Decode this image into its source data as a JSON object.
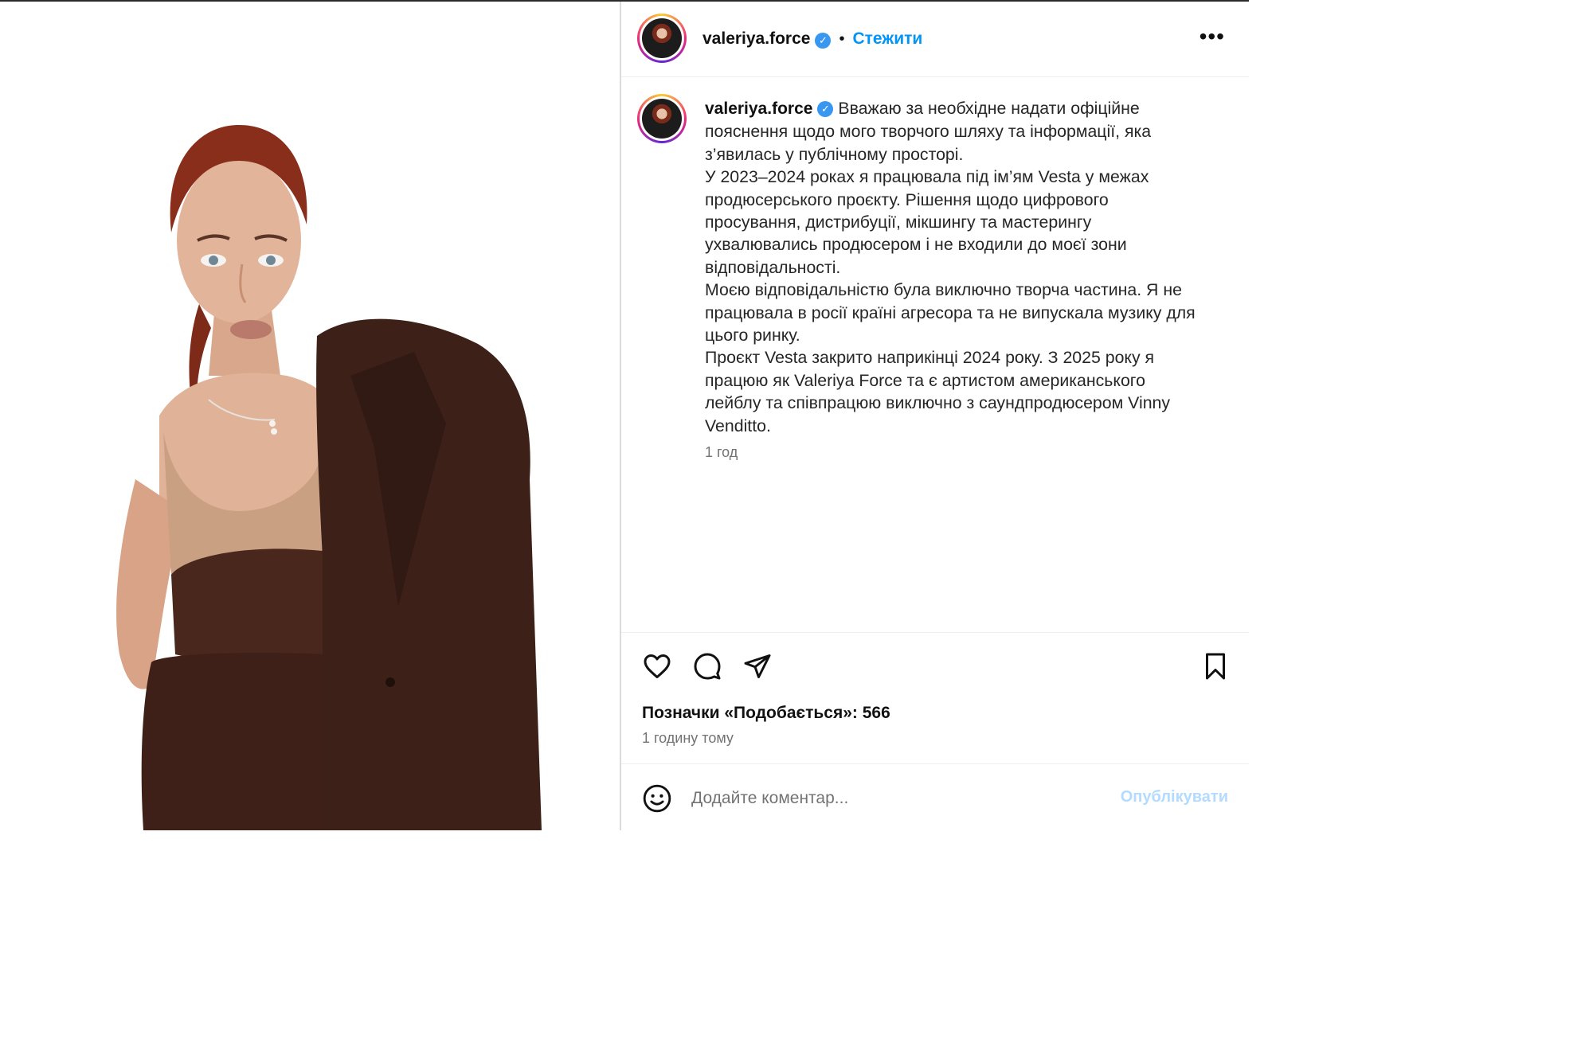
{
  "header": {
    "username": "valeriya.force",
    "separator": "•",
    "follow_label": "Стежити",
    "more_label": "•••"
  },
  "caption": {
    "username": "valeriya.force",
    "paragraphs": [
      "Вважаю за необхідне надати офіційне пояснення щодо мого творчого шляху та інформації, яка з’явилась у публічному просторі.",
      "У 2023–2024 роках я працювала під ім’ям Vesta у межах продюсерського проєкту. Рішення щодо цифрового просування, дистрибуції, мікшингу та мастерингу ухвалювались продюсером і не входили до моєї зони відповідальності.",
      "Моєю відповідальністю була виключно творча частина. Я не працювала в росії країні агресора та не випускала музику для цього ринку.",
      "Проєкт Vesta закрито наприкінці 2024 року. З 2025 року я працюю як Valeriya Force та є артистом американського лейблу та співпрацюю виключно з саундпродюсером Vinny Venditto."
    ],
    "time": "1 год"
  },
  "actions": {
    "likes_text": "Позначки «Подобається»: 566",
    "posted_ago": "1 годину тому"
  },
  "comment": {
    "placeholder": "Додайте коментар...",
    "publish_label": "Опублікувати"
  },
  "icons": {
    "verified": "verified-badge-icon",
    "like": "heart-icon",
    "comment": "comment-bubble-icon",
    "share": "paper-plane-icon",
    "save": "bookmark-icon",
    "emoji": "smiley-icon",
    "more": "ellipsis-icon"
  },
  "colors": {
    "link": "#0095f6",
    "verified": "#3897f0",
    "muted": "#737373",
    "publish_disabled": "#b3dbff",
    "jacket": "#3d2119",
    "hair": "#8a2e1c"
  }
}
